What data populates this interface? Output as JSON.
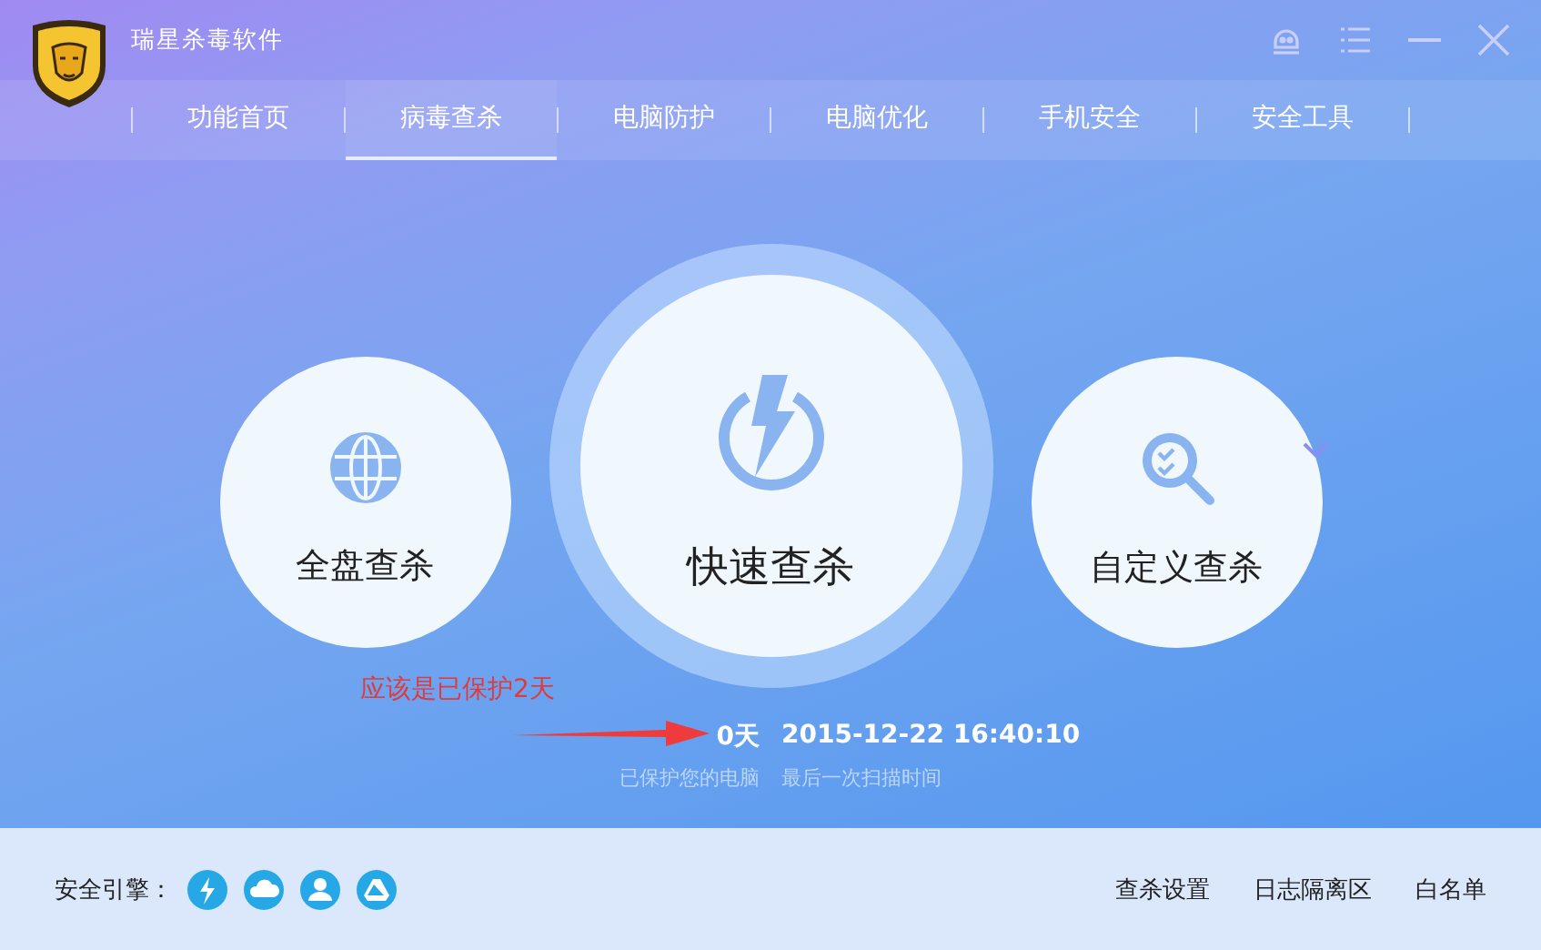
{
  "window": {
    "title": "瑞星杀毒软件"
  },
  "tabs": [
    {
      "label": "功能首页",
      "selected": false
    },
    {
      "label": "病毒查杀",
      "selected": true
    },
    {
      "label": "电脑防护",
      "selected": false
    },
    {
      "label": "电脑优化",
      "selected": false
    },
    {
      "label": "手机安全",
      "selected": false
    },
    {
      "label": "安全工具",
      "selected": false
    }
  ],
  "scan_buttons": [
    {
      "label": "全盘查杀",
      "kind": "full"
    },
    {
      "label": "快速查杀",
      "kind": "quick"
    },
    {
      "label": "自定义查杀",
      "kind": "custom"
    }
  ],
  "stats": [
    {
      "value": "0天",
      "caption": "已保护您的电脑"
    },
    {
      "value": "2015-12-22 16:40:10",
      "caption": "最后一次扫描时间"
    }
  ],
  "annotation": {
    "text": "应该是已保护2天"
  },
  "footer": {
    "engine_label": "安全引擎：",
    "engines": [
      {
        "kind": "lightning"
      },
      {
        "kind": "cloud"
      },
      {
        "kind": "user"
      },
      {
        "kind": "drive"
      }
    ],
    "links": [
      "查杀设置",
      "日志隔离区",
      "白名单"
    ]
  }
}
